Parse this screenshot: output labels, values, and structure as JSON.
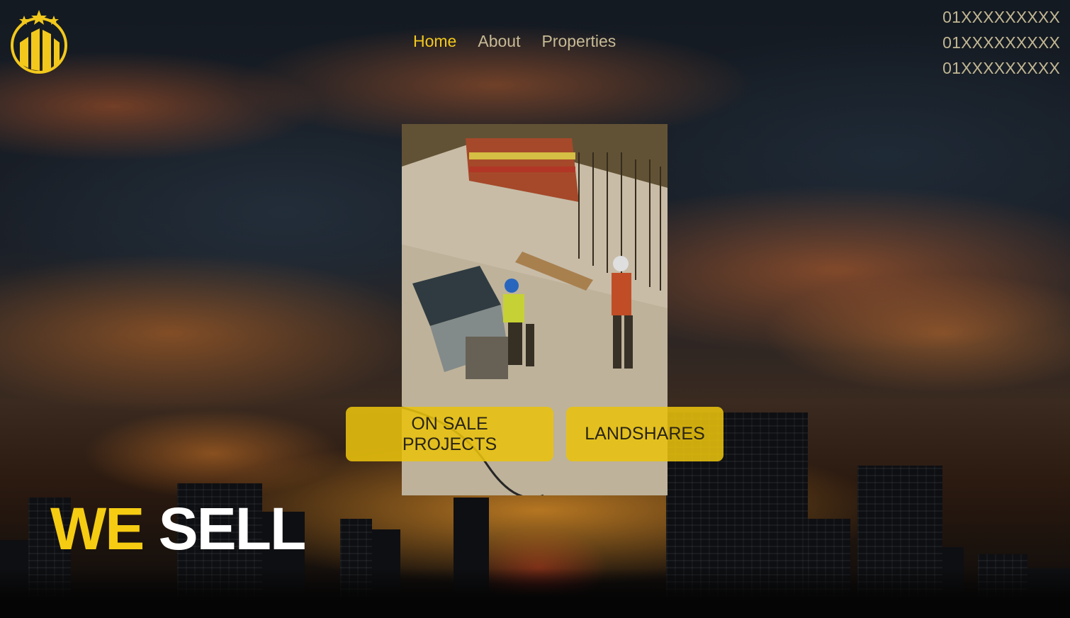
{
  "header": {
    "logo_icon": "building-stars-logo",
    "nav": [
      {
        "label": "Home",
        "active": true
      },
      {
        "label": "About",
        "active": false
      },
      {
        "label": "Properties",
        "active": false
      }
    ],
    "phones": [
      "01XXXXXXXXX",
      "01XXXXXXXXX",
      "01XXXXXXXXX"
    ]
  },
  "hero": {
    "photo_description": "construction-workers-photo",
    "buttons": {
      "on_sale": "ON SALE PROJECTS",
      "landshares": "LANDSHARES"
    },
    "tagline": {
      "part1": "WE",
      "part2": "SELL"
    }
  },
  "colors": {
    "accent": "#f2c81c",
    "nav_text": "#c7ba95",
    "button_bg": "#e8c20e"
  }
}
